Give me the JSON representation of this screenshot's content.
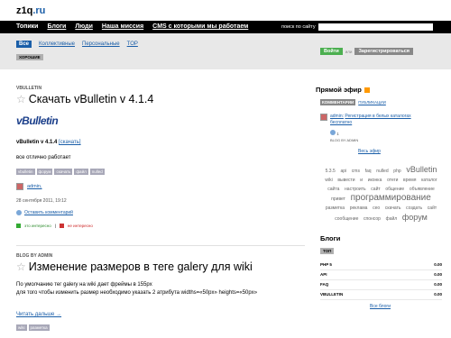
{
  "logo": {
    "name": "z1q",
    "tld": ".ru"
  },
  "topnav": {
    "items": [
      "Топики",
      "Блоги",
      "Люди",
      "Наша миссия",
      "CMS с которыми мы работаем"
    ],
    "search_label": "поиск по сайту",
    "search_value": ""
  },
  "filters": {
    "items": [
      "Все",
      "Коллективные",
      "Персональные",
      "TOP"
    ],
    "good": "ХОРОШИЕ"
  },
  "auth": {
    "login": "Войти",
    "or": "или",
    "register": "Зарегистрироваться"
  },
  "post1": {
    "blog": "VBULLETIN",
    "title": "Скачать vBulletin v 4.1.4",
    "logo_text": "vBulletin",
    "line_bold": "vBulletin v 4.1.4",
    "line_link": "[скачать]",
    "body": "все отлично работает",
    "tags": [
      "vbulletin",
      "форум",
      "скачать",
      "файл",
      "nulled"
    ],
    "author": "admin,",
    "date": "28 сентября 2011, 19:12",
    "leave_comment": "Оставить комментарий",
    "vote_up": "это интересно",
    "vote_sep": "|",
    "vote_down": "не интересно"
  },
  "post2": {
    "blog": "BLOG BY ADMIN",
    "title": "Изменение размеров в теге galery для wiki",
    "body1": "По умолчанию тег galery на wiki дает фреймы в 155px",
    "body2": "для того чтобы изменить размер необходимо указать 2 атрибута widths=«50px» heights=«50px»",
    "read_more": "Читать дальше →",
    "tags": [
      "wiki",
      "разметка"
    ]
  },
  "sidebar": {
    "live_title": "Прямой эфир",
    "tab_comments": "КОММЕНТАРИИ",
    "tab_pubs": "ПУБЛИКАЦИИ",
    "feed_author": "admin:",
    "feed_text": "Регистрация в белых каталогах бесплатно",
    "feed_count": "1",
    "feed_blog": "BLOG BY ADMIN",
    "all_feed": "Весь эфир",
    "cloud": [
      {
        "t": "5.3.5",
        "s": 5
      },
      {
        "t": "api",
        "s": 5
      },
      {
        "t": "cms",
        "s": 5
      },
      {
        "t": "faq",
        "s": 5
      },
      {
        "t": "nulled",
        "s": 5
      },
      {
        "t": "php",
        "s": 5
      },
      {
        "t": "vBulletin",
        "s": 9
      },
      {
        "t": "wiki",
        "s": 5
      },
      {
        "t": "вывести",
        "s": 5
      },
      {
        "t": "и",
        "s": 5
      },
      {
        "t": "иконка",
        "s": 5
      },
      {
        "t": "отеги",
        "s": 5
      },
      {
        "t": "время",
        "s": 5
      },
      {
        "t": "каталог",
        "s": 5
      },
      {
        "t": "сайта",
        "s": 5
      },
      {
        "t": "настроить",
        "s": 5
      },
      {
        "t": "сайт",
        "s": 5
      },
      {
        "t": "общение",
        "s": 5
      },
      {
        "t": "oбъявление",
        "s": 5
      },
      {
        "t": "привет",
        "s": 5
      },
      {
        "t": "программирование",
        "s": 10
      },
      {
        "t": "разметка",
        "s": 5
      },
      {
        "t": "реклама",
        "s": 5
      },
      {
        "t": "сео",
        "s": 5
      },
      {
        "t": "скачать",
        "s": 5
      },
      {
        "t": "создать",
        "s": 5
      },
      {
        "t": "сайт",
        "s": 5
      },
      {
        "t": "сообщение",
        "s": 5
      },
      {
        "t": "спонсор",
        "s": 5
      },
      {
        "t": "файл",
        "s": 5
      },
      {
        "t": "форум",
        "s": 9
      }
    ],
    "blogs_title": "Блоги",
    "blogs_top": "ТОП",
    "blogs": [
      {
        "name": "PHP 5",
        "rating": "0.00"
      },
      {
        "name": "API",
        "rating": "0.00"
      },
      {
        "name": "FAQ",
        "rating": "0.00"
      },
      {
        "name": "VBULLETIN",
        "rating": "0.00"
      }
    ],
    "all_blogs": "Все блоги"
  },
  "colors": {
    "accent": "#1a5ea8",
    "green": "#4caf50",
    "topbar": "#000000"
  }
}
